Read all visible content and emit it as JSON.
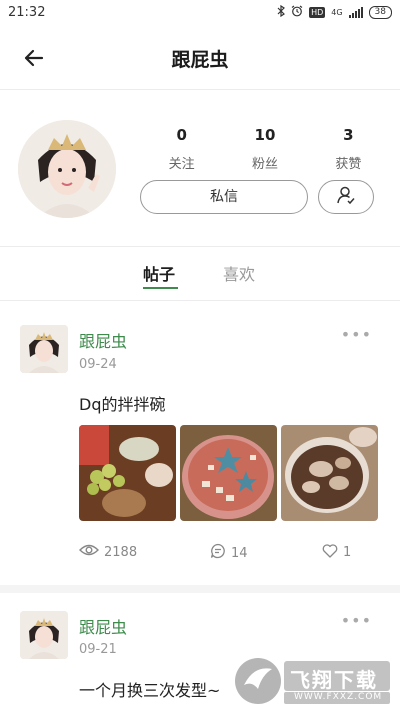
{
  "status_bar": {
    "time": "21:32",
    "network": "4G",
    "battery": "38",
    "icons": [
      "bluetooth-icon",
      "alarm-icon",
      "hd-icon",
      "signal-icon",
      "battery-icon"
    ]
  },
  "header": {
    "title": "跟屁虫",
    "back_icon": "arrow-left-icon"
  },
  "profile": {
    "stats": [
      {
        "value": "0",
        "label": "关注"
      },
      {
        "value": "10",
        "label": "粉丝"
      },
      {
        "value": "3",
        "label": "获赞"
      }
    ],
    "message_button": "私信",
    "follow_icon": "user-check-icon"
  },
  "tabs": {
    "active": "帖子",
    "inactive": "喜欢",
    "accent": "#3f8a4e"
  },
  "posts": [
    {
      "author": "跟屁虫",
      "date": "09-24",
      "title": "Dq的拌拌碗",
      "views": "2188",
      "comments": "14",
      "likes": "1"
    },
    {
      "author": "跟屁虫",
      "date": "09-21",
      "title": "一个月换三次发型~"
    }
  ],
  "watermark": {
    "text": "飞翔下载",
    "url": "WWW.FXXZ.COM"
  },
  "colors": {
    "author_green": "#3e8b4c",
    "divider": "#ececec",
    "muted": "#999999"
  }
}
